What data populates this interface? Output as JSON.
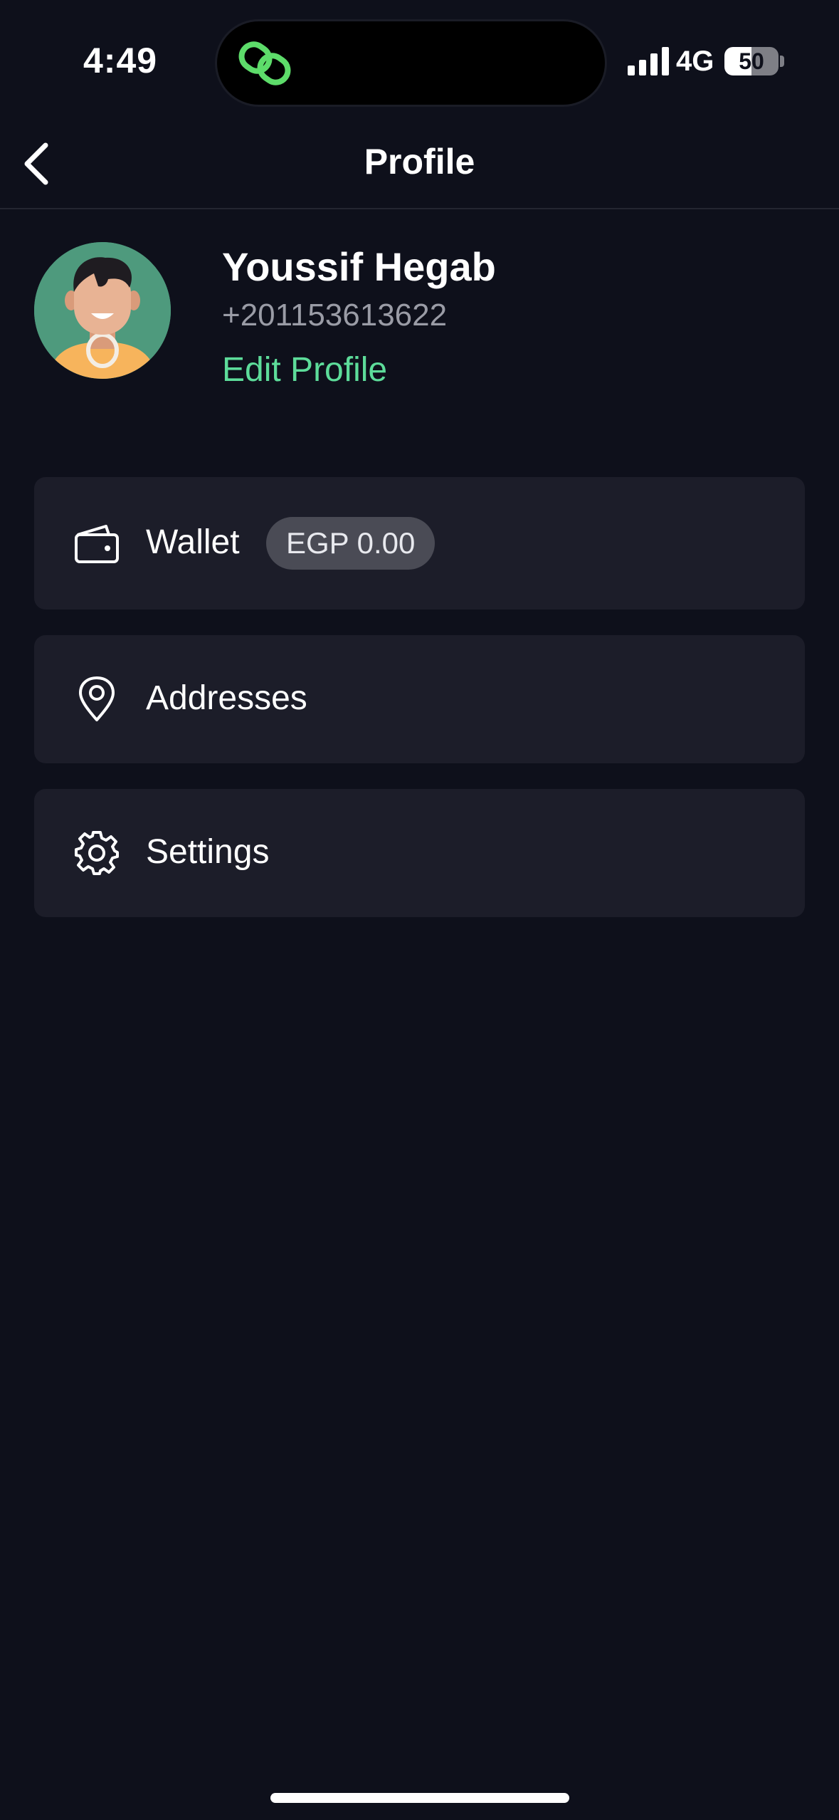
{
  "status_bar": {
    "time": "4:49",
    "network": "4G",
    "battery_level": "50",
    "battery_fraction": 0.5,
    "island_icon": "linked-rings-icon"
  },
  "nav": {
    "title": "Profile",
    "back_icon": "chevron-left-icon"
  },
  "profile": {
    "name": "Youssif Hegab",
    "phone": "+201153613622",
    "edit_label": "Edit Profile"
  },
  "menu": {
    "wallet": {
      "label": "Wallet",
      "balance": "EGP 0.00",
      "icon": "wallet-icon"
    },
    "addresses": {
      "label": "Addresses",
      "icon": "location-pin-icon"
    },
    "settings": {
      "label": "Settings",
      "icon": "gear-icon"
    }
  },
  "colors": {
    "background": "#0e101b",
    "card": "#1c1d29",
    "accent": "#5ddc9a",
    "muted_text": "#9a9ca6",
    "badge": "#4a4b55",
    "island_icon": "#5ddc6a"
  }
}
